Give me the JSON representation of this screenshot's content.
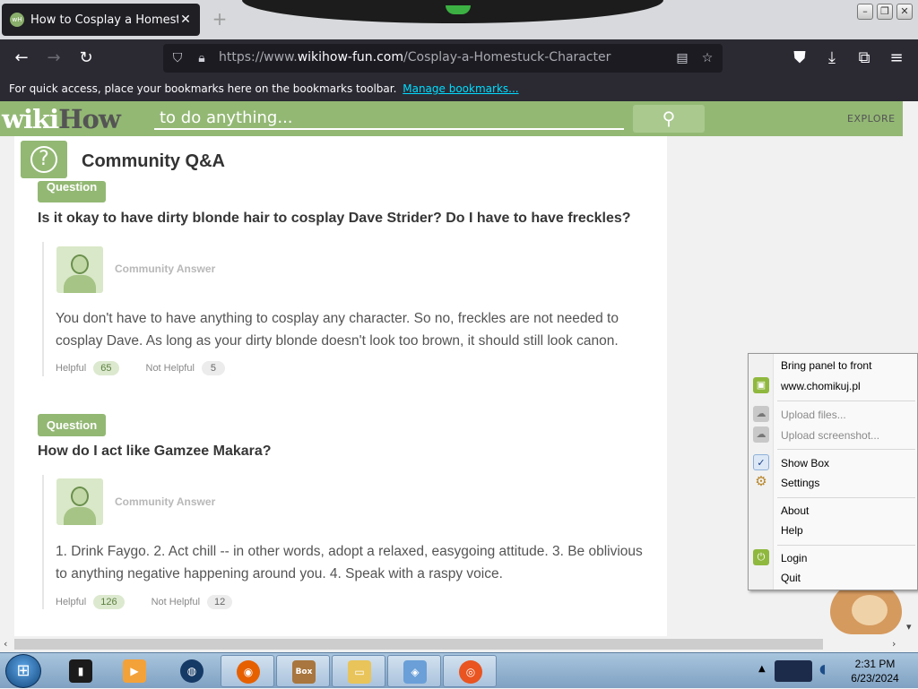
{
  "browser": {
    "tab_title": "How to Cosplay a Homestuck C",
    "tab_favicon": "wH",
    "new_tab": "+",
    "url_prefix": "https://www.",
    "url_host": "wikihow-fun.com",
    "url_path": "/Cosplay-a-Homestuck-Character",
    "bookmarks_text": "For quick access, place your bookmarks here on the bookmarks toolbar.",
    "bookmarks_link": "Manage bookmarks..."
  },
  "wikihow": {
    "logo_wiki": "wiki",
    "logo_how": "How",
    "search_text": "to do anything...",
    "explore": "EXPLORE"
  },
  "qa": {
    "section_title": "Community Q&A",
    "items": [
      {
        "tag": "Question",
        "question": "Is it okay to have dirty blonde hair to cosplay Dave Strider? Do I have to have freckles?",
        "answer_label": "Community Answer",
        "answer": "You don't have to have anything to cosplay any character. So no, freckles are not needed to cosplay Dave. As long as your dirty blonde doesn't look too brown, it should still look canon.",
        "helpful_label": "Helpful",
        "helpful_count": "65",
        "not_helpful_label": "Not Helpful",
        "not_helpful_count": "5"
      },
      {
        "tag": "Question",
        "question": "How do I act like Gamzee Makara?",
        "answer_label": "Community Answer",
        "answer": "1. Drink Faygo. 2. Act chill -- in other words, adopt a relaxed, easygoing attitude. 3. Be oblivious to anything negative happening around you. 4. Speak with a raspy voice.",
        "helpful_label": "Helpful",
        "helpful_count": "126",
        "not_helpful_label": "Not Helpful",
        "not_helpful_count": "12"
      }
    ]
  },
  "context_menu": {
    "items": [
      "Bring panel to front",
      "www.chomikuj.pl",
      "Upload files...",
      "Upload screenshot...",
      "Show Box",
      "Settings",
      "About",
      "Help",
      "Login",
      "Quit"
    ]
  },
  "taskbar": {
    "box_label": "Box",
    "time": "2:31 PM",
    "date": "6/23/2024"
  },
  "colors": {
    "wikihow_green": "#93b874",
    "browser_dark": "#2b2a33",
    "link_cyan": "#00ddff"
  }
}
